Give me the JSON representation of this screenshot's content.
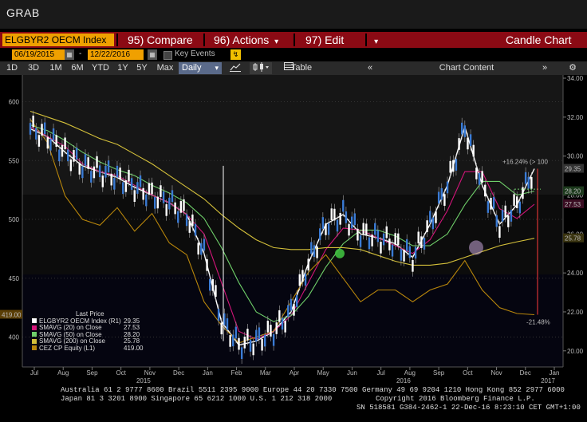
{
  "window": {
    "title": "GRAB"
  },
  "menu": {
    "ticker": "ELGBYR2 OECM Index",
    "compare": "95) Compare",
    "actions": "96) Actions",
    "edit": "97) Edit",
    "chart_type": "Candle Chart"
  },
  "date_range": {
    "start": "06/19/2015",
    "end": "12/22/2016",
    "key_events_label": "Key Events"
  },
  "toolbar": {
    "periods": [
      "1D",
      "3D",
      "1M",
      "6M",
      "YTD",
      "1Y",
      "5Y",
      "Max"
    ],
    "frequency": "Daily",
    "table_label": "Table",
    "chart_content_label": "Chart Content"
  },
  "chart_data": {
    "type": "line",
    "left_axis": {
      "ticks": [
        400,
        450,
        500,
        550,
        600
      ],
      "range": [
        380,
        620
      ]
    },
    "right_axis": {
      "ticks": [
        "34.00",
        "32.00",
        "30.00",
        "28.00",
        "26.00",
        "24.00",
        "22.00",
        "20.00"
      ],
      "range": [
        19.5,
        34
      ]
    },
    "x_ticks": [
      "Jul",
      "Aug",
      "Sep",
      "Oct",
      "Nov",
      "Dec",
      "Jan",
      "Feb",
      "Mar",
      "Apr",
      "May",
      "Jun",
      "Jul",
      "Aug",
      "Sep",
      "Oct",
      "Nov",
      "Dec",
      "Jan"
    ],
    "year_labels": [
      "2015",
      "2016",
      "2017"
    ],
    "series": [
      {
        "name": "ELGBYR2 OECM Index",
        "color": "#ffffff",
        "values": [
          31.4,
          31.0,
          30.2,
          29.5,
          29.2,
          28.9,
          28.4,
          28.0,
          27.6,
          27.0,
          25.0,
          21.5,
          20.3,
          20.5,
          21.0,
          22.0,
          24.5,
          26.5,
          27.0,
          26.0,
          25.8,
          25.5,
          24.8,
          26.5,
          28.5,
          31.5,
          28.5,
          26.5,
          27.5,
          29.35
        ]
      },
      {
        "name": "SMAVG (20) on Close",
        "color": "#d4157a",
        "values": [
          31.5,
          31.0,
          30.5,
          29.6,
          29.2,
          29.0,
          28.5,
          28.0,
          27.6,
          27.0,
          26.0,
          23.5,
          21.0,
          20.6,
          21.0,
          21.8,
          23.5,
          25.2,
          26.3,
          26.2,
          25.8,
          25.4,
          25.0,
          25.7,
          27.2,
          29.2,
          29.2,
          27.3,
          26.8,
          27.53
        ]
      },
      {
        "name": "SMAVG (50) on Close",
        "color": "#6fcf6a",
        "values": [
          31.6,
          31.3,
          30.8,
          30.2,
          29.7,
          29.3,
          29.0,
          28.5,
          28.1,
          27.6,
          26.8,
          25.3,
          23.5,
          22.0,
          21.5,
          21.8,
          22.8,
          24.3,
          25.5,
          26.2,
          26.2,
          25.9,
          25.4,
          25.4,
          26.0,
          27.5,
          28.7,
          28.7,
          28.0,
          28.2
        ]
      },
      {
        "name": "SMAVG (200) on Close",
        "color": "#d4c03a",
        "values": [
          32.3,
          32.0,
          31.7,
          31.3,
          30.9,
          30.6,
          30.1,
          29.6,
          29.0,
          28.4,
          27.8,
          27.0,
          26.3,
          25.7,
          25.3,
          25.2,
          25.2,
          25.3,
          25.3,
          25.2,
          24.9,
          24.6,
          24.4,
          24.4,
          24.5,
          24.8,
          25.1,
          25.4,
          25.6,
          25.78
        ]
      },
      {
        "name": "CEZ CP Equity (L1)",
        "color": "#b8860b",
        "values": [
          585,
          565,
          520,
          500,
          495,
          510,
          490,
          505,
          480,
          470,
          430,
          410,
          395,
          400,
          405,
          430,
          455,
          470,
          450,
          430,
          440,
          440,
          430,
          440,
          445,
          465,
          440,
          425,
          420,
          419
        ]
      }
    ],
    "last_prices": [
      "29.35",
      "27.53",
      "28.20",
      "25.78",
      "419.00"
    ],
    "right_markers": [
      "29.35",
      "28.20",
      "27.53",
      "25.78"
    ],
    "left_marker": "419.00",
    "annotations": [
      "+16.24% (> 100",
      "-21.48%"
    ]
  },
  "legend": {
    "title": "Last Price",
    "items": [
      {
        "label": "ELGBYR2 OECM Index (R1)",
        "value": "29.35",
        "color": "#ffffff"
      },
      {
        "label": "SMAVG (20) on Close",
        "value": "27.53",
        "color": "#d4157a"
      },
      {
        "label": "SMAVG (50) on Close",
        "value": "28.20",
        "color": "#6fcf6a"
      },
      {
        "label": "SMAVG (200) on Close",
        "value": "25.78",
        "color": "#d4c03a"
      },
      {
        "label": "CEZ CP Equity  (L1)",
        "value": "419.00",
        "color": "#b8860b"
      }
    ]
  },
  "footer": {
    "line1": "Australia 61 2 9777 8600 Brazil 5511 2395 9000 Europe 44 20 7330 7500 Germany 49 69 9204 1210 Hong Kong 852 2977 6000",
    "line2_left": "Japan 81 3 3201 8900       Singapore 65 6212 1000       U.S. 1 212 318 2000",
    "line2_right": "Copyright 2016 Bloomberg Finance L.P.",
    "line3": "SN 518581 G384-2462-1 22-Dec-16  8:23:10 CET  GMT+1:00"
  }
}
